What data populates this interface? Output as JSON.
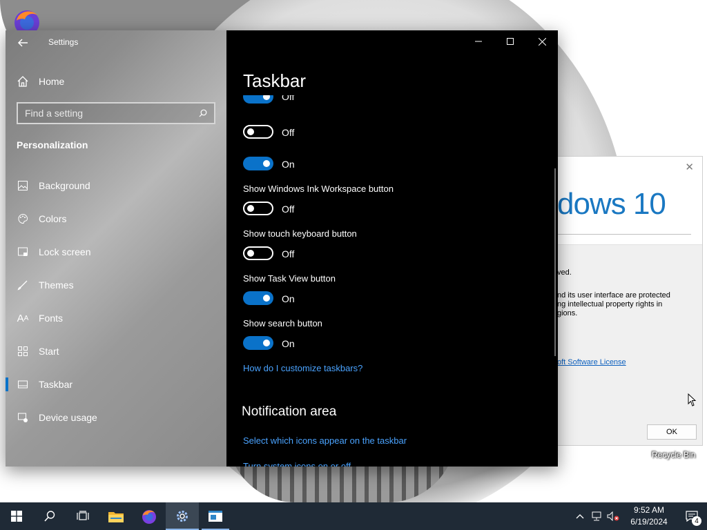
{
  "settings": {
    "title": "Settings",
    "home_label": "Home",
    "search_placeholder": "Find a setting",
    "section": "Personalization",
    "nav": [
      {
        "label": "Background",
        "icon": "image-icon"
      },
      {
        "label": "Colors",
        "icon": "palette-icon"
      },
      {
        "label": "Lock screen",
        "icon": "lock-screen-icon"
      },
      {
        "label": "Themes",
        "icon": "brush-icon"
      },
      {
        "label": "Fonts",
        "icon": "font-icon"
      },
      {
        "label": "Start",
        "icon": "start-grid-icon"
      },
      {
        "label": "Taskbar",
        "icon": "taskbar-icon",
        "active": true
      },
      {
        "label": "Device usage",
        "icon": "device-usage-icon"
      }
    ],
    "page_title": "Taskbar",
    "toggles": {
      "partial_top": {
        "state": "Off",
        "on": true
      },
      "unnamed_1": {
        "state": "Off",
        "on": false
      },
      "unnamed_2": {
        "state": "On",
        "on": true
      },
      "ink_workspace": {
        "label": "Show Windows Ink Workspace button",
        "state": "Off",
        "on": false
      },
      "touch_keyboard": {
        "label": "Show touch keyboard button",
        "state": "Off",
        "on": false
      },
      "task_view": {
        "label": "Show Task View button",
        "state": "On",
        "on": true
      },
      "search_button": {
        "label": "Show search button",
        "state": "On",
        "on": true
      }
    },
    "customize_link": "How do I customize taskbars?",
    "notification_heading": "Notification area",
    "notification_link1": "Select which icons appear on the taskbar",
    "notification_link2_partial": "Turn system icons on or off"
  },
  "winver": {
    "logo_text": "dows 10",
    "line1": "ved.",
    "line2": "nd its user interface are protected\nng intellectual property rights in\ngions.",
    "license_link": "oft Software License",
    "ok_label": "OK"
  },
  "desktop": {
    "recycle_bin": "Recycle Bin"
  },
  "taskbar": {
    "time": "9:52 AM",
    "date": "6/19/2024",
    "notification_count": "4"
  },
  "colors": {
    "accent": "#0a72c9",
    "link": "#4aa3ff",
    "taskbar_bg": "#1f2a36"
  }
}
